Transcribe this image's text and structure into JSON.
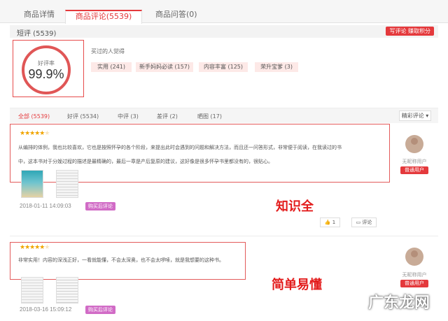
{
  "tabs": [
    {
      "label": "商品详情"
    },
    {
      "label": "商品评论(5539)"
    },
    {
      "label": "商品问答(0)"
    }
  ],
  "short_review": {
    "title": "短评 (5539)",
    "button": "写评论 赚取积分"
  },
  "rating": {
    "label": "好评率",
    "value": "99.9%"
  },
  "impressions": {
    "title": "买过的人觉得",
    "tags": [
      "实用 (241)",
      "新手妈妈必读 (157)",
      "内容丰富 (125)",
      "荣升宝爹 (3)"
    ]
  },
  "filters": [
    "全部 (5539)",
    "好评 (5534)",
    "中评 (3)",
    "差评 (2)",
    "晒图 (17)"
  ],
  "sort_label": "精彩评论",
  "reviews": [
    {
      "text_line1": "从编排的体例，我也比较喜欢，它也是按照怀孕的各个阶段，来提出此时会遇到的问题和解决方法，而且还一问答形式，非常便于阅读，在我读过的书",
      "text_line2": "中，这本书对于分娩过程的描述是最精确的，最后一章是产后复原的建议，这好像是很多怀孕书里都没有的，很贴心。",
      "date": "2018-01-11 14:09:03",
      "badge": "购买后评论",
      "user": "无昵称用户",
      "level": "普通用户",
      "likes": "1",
      "comment_label": "评论",
      "annotation": "知识全"
    },
    {
      "text_line1": "非常实用！内容的深浅正好，一看就能懂，不会太深奥，也不会太啰嗦，就是我想要的这种书。",
      "date": "2018-03-16 15:09:12",
      "badge": "购买后评论",
      "user": "无昵称用户",
      "level": "普通用户",
      "annotation": "简单易懂"
    }
  ],
  "watermark": "广东龙网"
}
